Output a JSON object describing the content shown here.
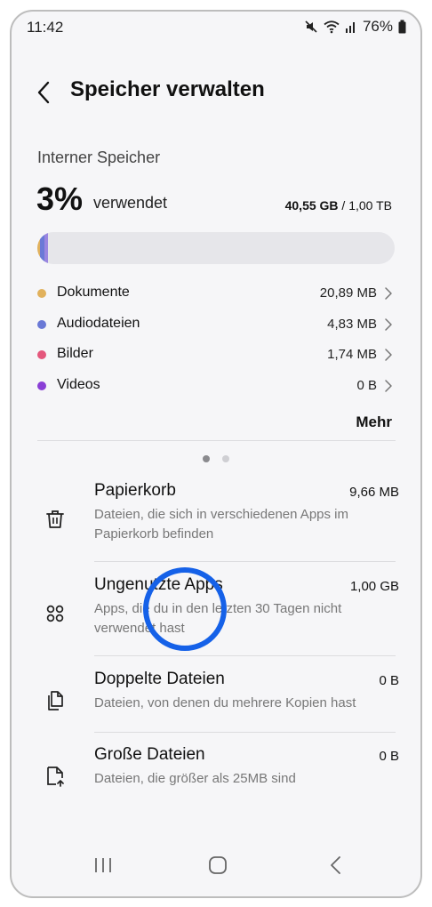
{
  "status_bar": {
    "time": "11:42",
    "battery": "76%"
  },
  "header": {
    "title": "Speicher verwalten"
  },
  "storage": {
    "section_title": "Interner Speicher",
    "percent": "3%",
    "percent_label": "verwendet",
    "used": "40,55 GB",
    "separator": " / ",
    "total": "1,00 TB",
    "fill_fraction": 0.03
  },
  "categories": [
    {
      "label": "Dokumente",
      "size": "20,89 MB",
      "color": "#e1b15c"
    },
    {
      "label": "Audiodateien",
      "size": "4,83 MB",
      "color": "#6a79d6"
    },
    {
      "label": "Bilder",
      "size": "1,74 MB",
      "color": "#e4577c"
    },
    {
      "label": "Videos",
      "size": "0 B",
      "color": "#8a3fd6"
    }
  ],
  "more_label": "Mehr",
  "cleanup_items": [
    {
      "title": "Papierkorb",
      "size": "9,66 MB",
      "desc": "Dateien, die sich in verschiedenen Apps im Papierkorb befinden",
      "icon": "trash-icon"
    },
    {
      "title": "Ungenutzte Apps",
      "size": "1,00 GB",
      "desc": "Apps, die du in den letzten 30 Tagen nicht verwendet hast",
      "icon": "apps-grid-icon"
    },
    {
      "title": "Doppelte Dateien",
      "size": "0 B",
      "desc": "Dateien, von denen du mehrere Kopien hast",
      "icon": "duplicate-files-icon"
    },
    {
      "title": "Große Dateien",
      "size": "0 B",
      "desc": "Dateien, die größer als 25MB sind",
      "icon": "large-file-icon"
    }
  ],
  "colors": {
    "accent": "#1561e8",
    "background": "#f6f6f8"
  }
}
